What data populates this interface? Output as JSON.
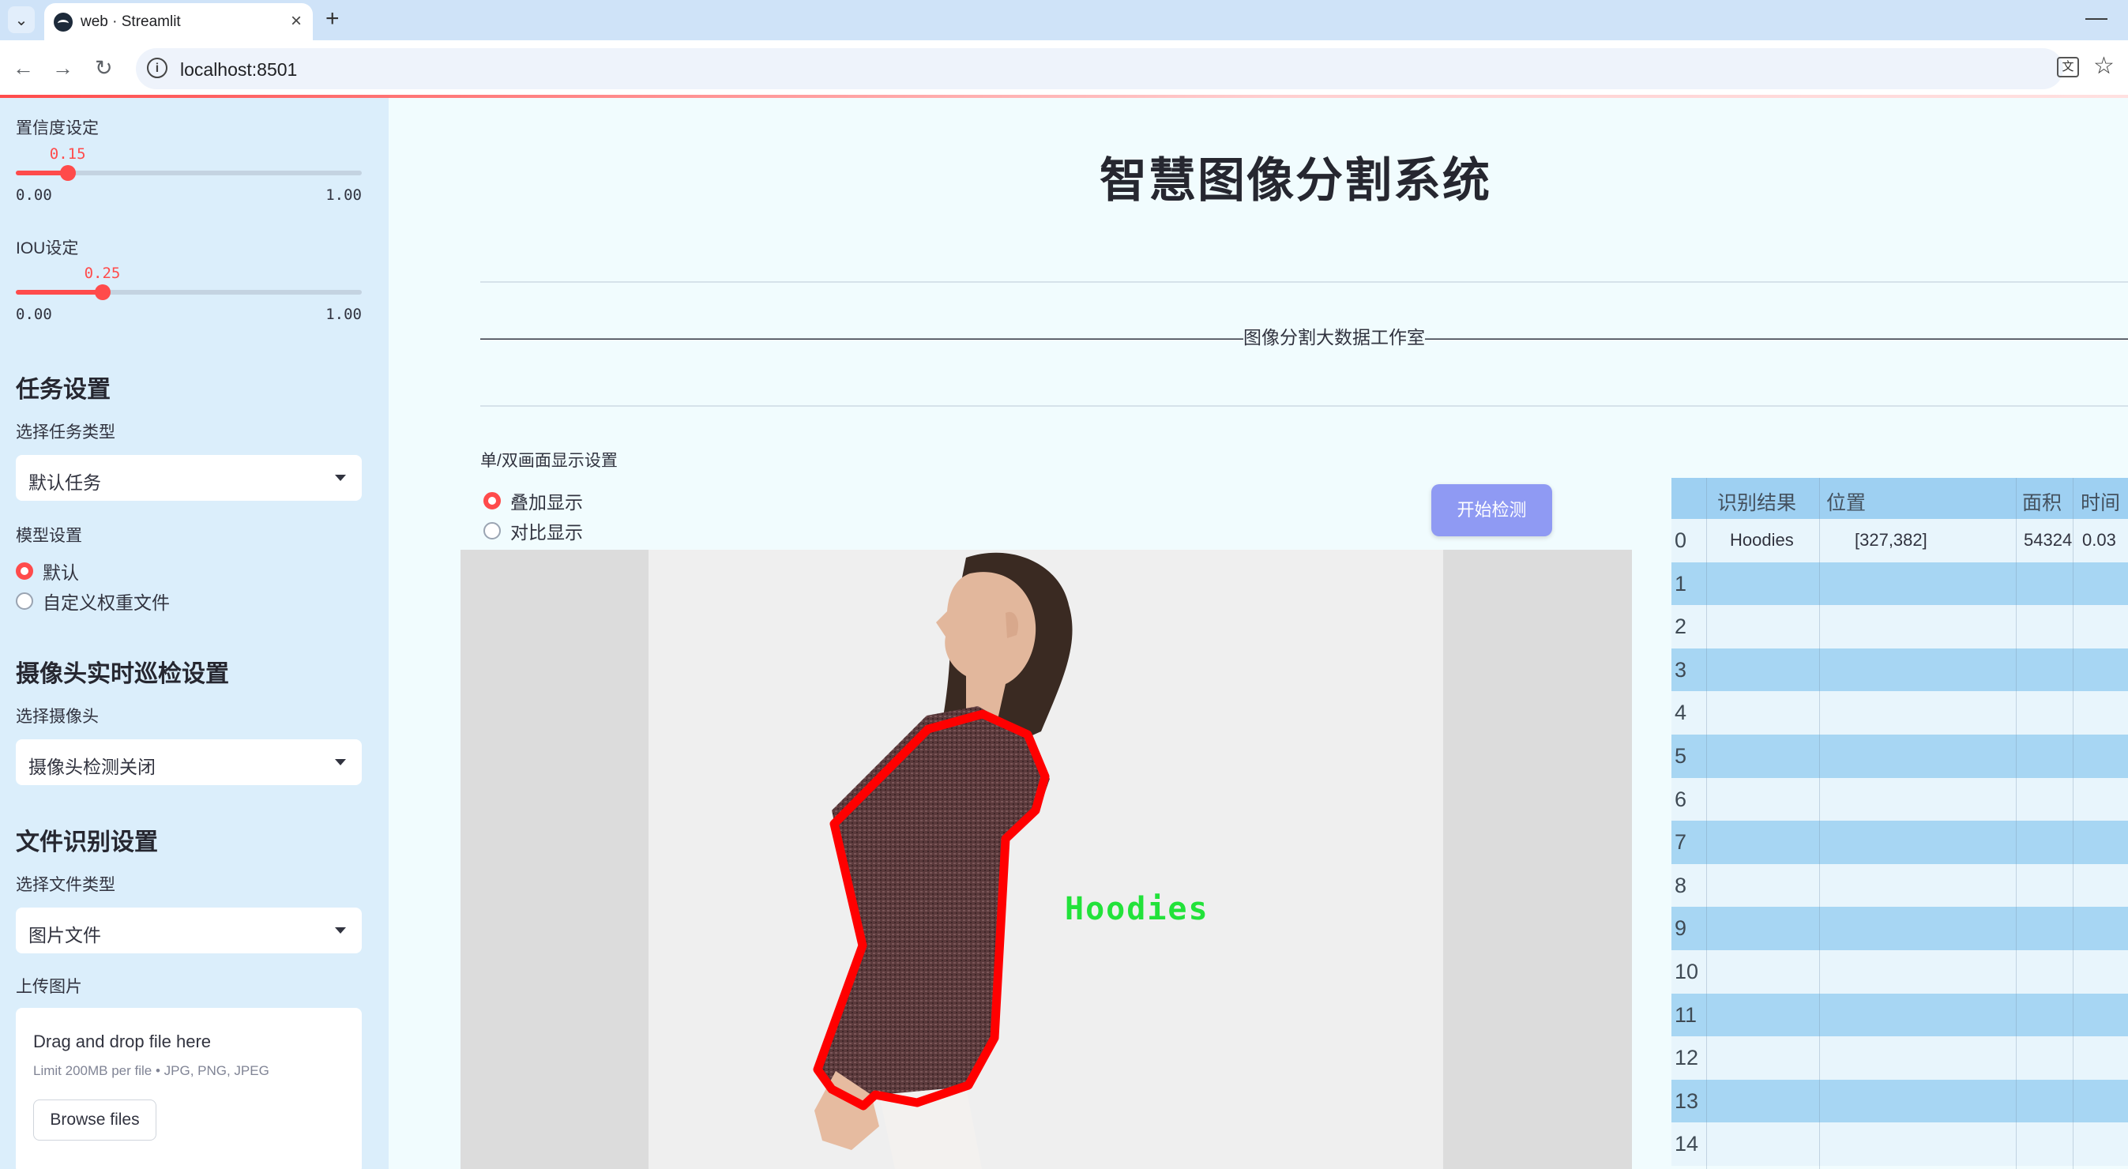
{
  "browser": {
    "tab_title": "web · Streamlit",
    "url": "localhost:8501"
  },
  "sidebar": {
    "confidence": {
      "label": "置信度设定",
      "value": "0.15",
      "min": "0.00",
      "max": "1.00",
      "fraction": 0.15
    },
    "iou": {
      "label": "IOU设定",
      "value": "0.25",
      "min": "0.00",
      "max": "1.00",
      "fraction": 0.25
    },
    "task_header": "任务设置",
    "task_type_label": "选择任务类型",
    "task_type_value": "默认任务",
    "model_label": "模型设置",
    "model_options": [
      "默认",
      "自定义权重文件"
    ],
    "model_selected": 0,
    "camera_header": "摄像头实时巡检设置",
    "camera_label": "选择摄像头",
    "camera_value": "摄像头检测关闭",
    "file_header": "文件识别设置",
    "file_type_label": "选择文件类型",
    "file_type_value": "图片文件",
    "upload_label": "上传图片",
    "upload_title": "Drag and drop file here",
    "upload_limit": "Limit 200MB per file • JPG, PNG, JPEG",
    "browse_label": "Browse files"
  },
  "main": {
    "title": "智慧图像分割系统",
    "subtitle_line": "——————————————————————————————————————————图像分割大数据工作室——————————————————————————————————————————",
    "display_label": "单/双画面显示设置",
    "display_options": [
      "叠加显示",
      "对比显示"
    ],
    "display_selected": 0,
    "start_button": "开始检测",
    "detection_label": "Hoodies"
  },
  "table": {
    "headers": [
      "识别结果",
      "位置",
      "面积",
      "时间"
    ],
    "rows": [
      {
        "idx": "0",
        "result": "Hoodies",
        "position": "[327,382]",
        "area": "54324",
        "time": "0.03"
      },
      {
        "idx": "1"
      },
      {
        "idx": "2"
      },
      {
        "idx": "3"
      },
      {
        "idx": "4"
      },
      {
        "idx": "5"
      },
      {
        "idx": "6"
      },
      {
        "idx": "7"
      },
      {
        "idx": "8"
      },
      {
        "idx": "9"
      },
      {
        "idx": "10"
      },
      {
        "idx": "11"
      },
      {
        "idx": "12"
      },
      {
        "idx": "13"
      },
      {
        "idx": "14"
      }
    ]
  },
  "colors": {
    "accent": "#ff4b4b",
    "button": "#8f9af3",
    "mask_outline": "#ff0000",
    "label_text": "#22e23a"
  }
}
